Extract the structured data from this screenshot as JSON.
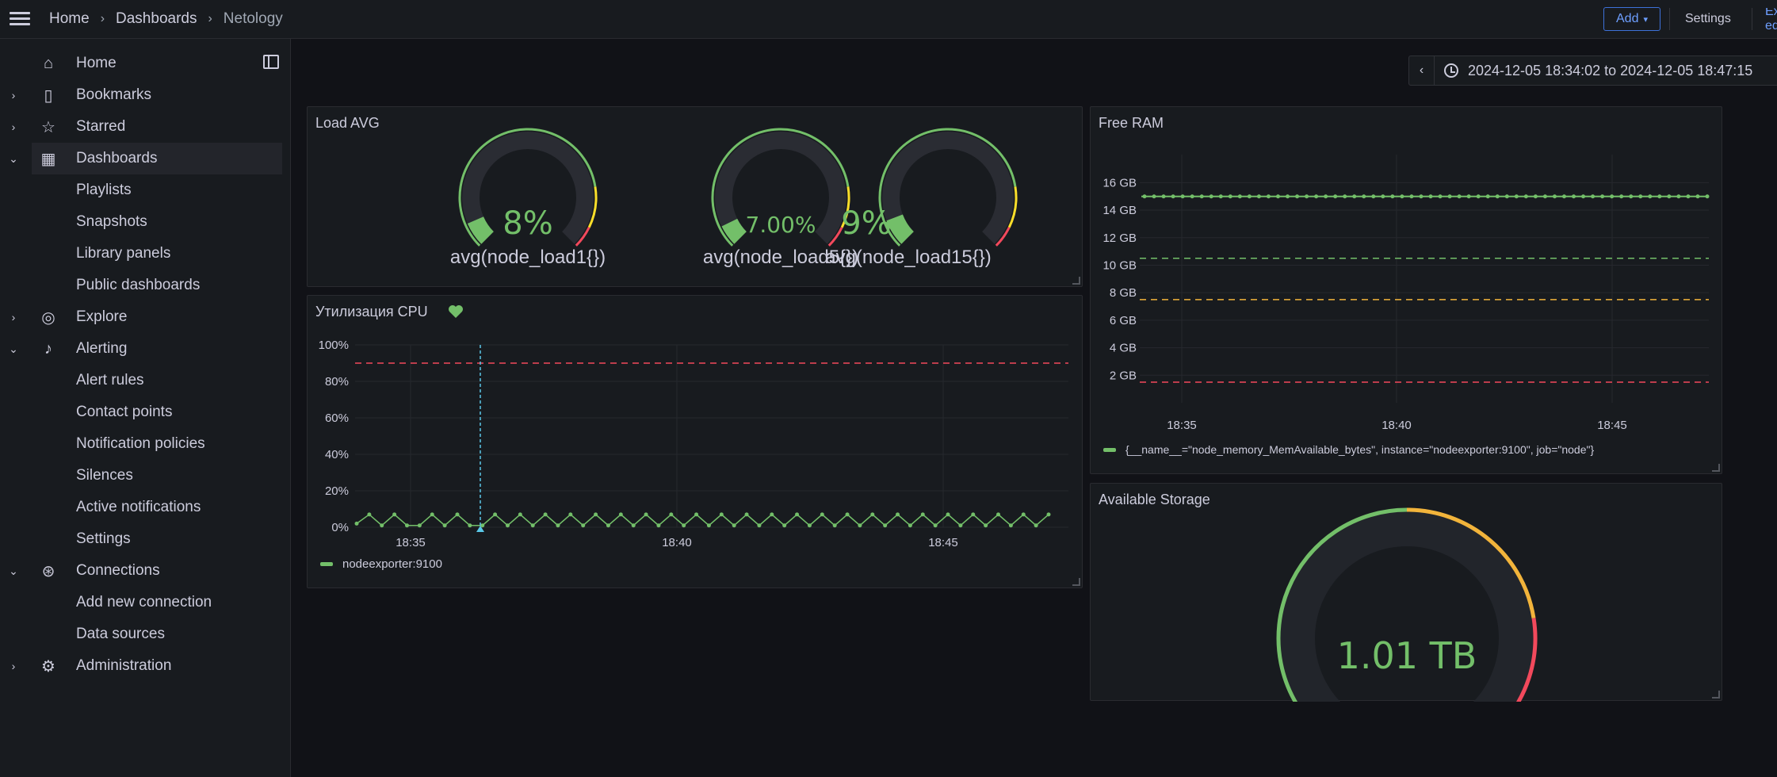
{
  "topbar": {
    "breadcrumbs": [
      "Home",
      "Dashboards",
      "Netology"
    ],
    "add_label": "Add",
    "settings_label": "Settings",
    "edit_label": "Exit edit"
  },
  "sidebar": {
    "items": [
      {
        "label": "Home",
        "icon": "home-icon"
      },
      {
        "label": "Bookmarks",
        "icon": "bookmark-icon"
      },
      {
        "label": "Starred",
        "icon": "star-icon"
      },
      {
        "label": "Dashboards",
        "icon": "apps-icon"
      },
      {
        "label": "Playlists"
      },
      {
        "label": "Snapshots"
      },
      {
        "label": "Library panels"
      },
      {
        "label": "Public dashboards"
      },
      {
        "label": "Explore",
        "icon": "compass-icon"
      },
      {
        "label": "Alerting",
        "icon": "bell-icon"
      },
      {
        "label": "Alert rules"
      },
      {
        "label": "Contact points"
      },
      {
        "label": "Notification policies"
      },
      {
        "label": "Silences"
      },
      {
        "label": "Active notifications"
      },
      {
        "label": "Settings"
      },
      {
        "label": "Connections",
        "icon": "plug-icon"
      },
      {
        "label": "Add new connection"
      },
      {
        "label": "Data sources"
      },
      {
        "label": "Administration",
        "icon": "cog-icon"
      }
    ]
  },
  "timepicker": {
    "range": "2024-12-05 18:34:02 to 2024-12-05 18:47:15"
  },
  "panels": {
    "load_avg": {
      "title": "Load AVG",
      "gauges": [
        {
          "value": "8%",
          "label": "avg(node_load1{})",
          "fraction": 0.08
        },
        {
          "value": "7.00%",
          "label": "avg(node_load5{})",
          "fraction": 0.07
        },
        {
          "value": "9%",
          "label": "avg(node_load15{})",
          "fraction": 0.09
        }
      ]
    },
    "cpu": {
      "title": "Утилизация CPU",
      "legend": "nodeexporter:9100"
    },
    "free_ram": {
      "title": "Free RAM",
      "legend": "{__name__=\"node_memory_MemAvailable_bytes\", instance=\"nodeexporter:9100\", job=\"node\"}"
    },
    "storage": {
      "title": "Available Storage",
      "value": "1.01 TB",
      "fraction": 0.0
    }
  },
  "colors": {
    "green": "#73bf69",
    "yellow": "#fade2a",
    "orange": "#f2b43b",
    "red": "#f2495c",
    "cyan": "#5ac8e8"
  },
  "chart_data": [
    {
      "type": "line",
      "title": "Утилизация CPU",
      "x_ticks": [
        "18:35",
        "18:40",
        "18:45"
      ],
      "y_ticks": [
        "0%",
        "20%",
        "40%",
        "60%",
        "80%",
        "100%"
      ],
      "ylim": [
        0,
        100
      ],
      "thresholds": [
        90
      ],
      "series": [
        {
          "name": "nodeexporter:9100",
          "values": [
            2,
            7,
            1,
            7,
            1,
            1,
            7,
            1,
            7,
            1,
            1,
            7,
            1,
            7,
            1,
            7,
            1,
            7,
            1,
            7,
            1,
            7,
            1,
            7,
            1,
            7,
            1,
            7,
            1,
            7,
            1,
            7,
            1,
            7,
            1,
            7,
            1,
            7,
            1,
            7,
            1,
            7,
            1,
            7,
            1,
            7,
            1,
            7,
            1,
            7,
            1,
            7,
            1,
            7,
            1,
            7
          ]
        }
      ]
    },
    {
      "type": "line",
      "title": "Free RAM",
      "x_ticks": [
        "18:35",
        "18:40",
        "18:45"
      ],
      "y_ticks": [
        "2 GB",
        "4 GB",
        "6 GB",
        "8 GB",
        "10 GB",
        "12 GB",
        "14 GB",
        "16 GB"
      ],
      "ylim": [
        0,
        17
      ],
      "thresholds": [
        1.5,
        7.5,
        10.5
      ],
      "series": [
        {
          "name": "{__name__=\"node_memory_MemAvailable_bytes\", instance=\"nodeexporter:9100\", job=\"node\"}",
          "value": 15.0
        }
      ]
    }
  ]
}
